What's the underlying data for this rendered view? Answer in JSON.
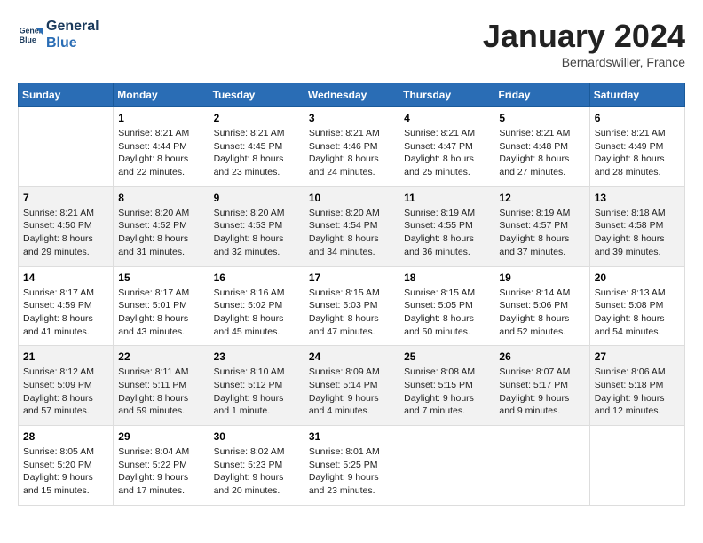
{
  "header": {
    "logo_line1": "General",
    "logo_line2": "Blue",
    "month": "January 2024",
    "location": "Bernardswiller, France"
  },
  "columns": [
    "Sunday",
    "Monday",
    "Tuesday",
    "Wednesday",
    "Thursday",
    "Friday",
    "Saturday"
  ],
  "rows": [
    [
      {
        "day": "",
        "info": ""
      },
      {
        "day": "1",
        "info": "Sunrise: 8:21 AM\nSunset: 4:44 PM\nDaylight: 8 hours\nand 22 minutes."
      },
      {
        "day": "2",
        "info": "Sunrise: 8:21 AM\nSunset: 4:45 PM\nDaylight: 8 hours\nand 23 minutes."
      },
      {
        "day": "3",
        "info": "Sunrise: 8:21 AM\nSunset: 4:46 PM\nDaylight: 8 hours\nand 24 minutes."
      },
      {
        "day": "4",
        "info": "Sunrise: 8:21 AM\nSunset: 4:47 PM\nDaylight: 8 hours\nand 25 minutes."
      },
      {
        "day": "5",
        "info": "Sunrise: 8:21 AM\nSunset: 4:48 PM\nDaylight: 8 hours\nand 27 minutes."
      },
      {
        "day": "6",
        "info": "Sunrise: 8:21 AM\nSunset: 4:49 PM\nDaylight: 8 hours\nand 28 minutes."
      }
    ],
    [
      {
        "day": "7",
        "info": "Sunrise: 8:21 AM\nSunset: 4:50 PM\nDaylight: 8 hours\nand 29 minutes."
      },
      {
        "day": "8",
        "info": "Sunrise: 8:20 AM\nSunset: 4:52 PM\nDaylight: 8 hours\nand 31 minutes."
      },
      {
        "day": "9",
        "info": "Sunrise: 8:20 AM\nSunset: 4:53 PM\nDaylight: 8 hours\nand 32 minutes."
      },
      {
        "day": "10",
        "info": "Sunrise: 8:20 AM\nSunset: 4:54 PM\nDaylight: 8 hours\nand 34 minutes."
      },
      {
        "day": "11",
        "info": "Sunrise: 8:19 AM\nSunset: 4:55 PM\nDaylight: 8 hours\nand 36 minutes."
      },
      {
        "day": "12",
        "info": "Sunrise: 8:19 AM\nSunset: 4:57 PM\nDaylight: 8 hours\nand 37 minutes."
      },
      {
        "day": "13",
        "info": "Sunrise: 8:18 AM\nSunset: 4:58 PM\nDaylight: 8 hours\nand 39 minutes."
      }
    ],
    [
      {
        "day": "14",
        "info": "Sunrise: 8:17 AM\nSunset: 4:59 PM\nDaylight: 8 hours\nand 41 minutes."
      },
      {
        "day": "15",
        "info": "Sunrise: 8:17 AM\nSunset: 5:01 PM\nDaylight: 8 hours\nand 43 minutes."
      },
      {
        "day": "16",
        "info": "Sunrise: 8:16 AM\nSunset: 5:02 PM\nDaylight: 8 hours\nand 45 minutes."
      },
      {
        "day": "17",
        "info": "Sunrise: 8:15 AM\nSunset: 5:03 PM\nDaylight: 8 hours\nand 47 minutes."
      },
      {
        "day": "18",
        "info": "Sunrise: 8:15 AM\nSunset: 5:05 PM\nDaylight: 8 hours\nand 50 minutes."
      },
      {
        "day": "19",
        "info": "Sunrise: 8:14 AM\nSunset: 5:06 PM\nDaylight: 8 hours\nand 52 minutes."
      },
      {
        "day": "20",
        "info": "Sunrise: 8:13 AM\nSunset: 5:08 PM\nDaylight: 8 hours\nand 54 minutes."
      }
    ],
    [
      {
        "day": "21",
        "info": "Sunrise: 8:12 AM\nSunset: 5:09 PM\nDaylight: 8 hours\nand 57 minutes."
      },
      {
        "day": "22",
        "info": "Sunrise: 8:11 AM\nSunset: 5:11 PM\nDaylight: 8 hours\nand 59 minutes."
      },
      {
        "day": "23",
        "info": "Sunrise: 8:10 AM\nSunset: 5:12 PM\nDaylight: 9 hours\nand 1 minute."
      },
      {
        "day": "24",
        "info": "Sunrise: 8:09 AM\nSunset: 5:14 PM\nDaylight: 9 hours\nand 4 minutes."
      },
      {
        "day": "25",
        "info": "Sunrise: 8:08 AM\nSunset: 5:15 PM\nDaylight: 9 hours\nand 7 minutes."
      },
      {
        "day": "26",
        "info": "Sunrise: 8:07 AM\nSunset: 5:17 PM\nDaylight: 9 hours\nand 9 minutes."
      },
      {
        "day": "27",
        "info": "Sunrise: 8:06 AM\nSunset: 5:18 PM\nDaylight: 9 hours\nand 12 minutes."
      }
    ],
    [
      {
        "day": "28",
        "info": "Sunrise: 8:05 AM\nSunset: 5:20 PM\nDaylight: 9 hours\nand 15 minutes."
      },
      {
        "day": "29",
        "info": "Sunrise: 8:04 AM\nSunset: 5:22 PM\nDaylight: 9 hours\nand 17 minutes."
      },
      {
        "day": "30",
        "info": "Sunrise: 8:02 AM\nSunset: 5:23 PM\nDaylight: 9 hours\nand 20 minutes."
      },
      {
        "day": "31",
        "info": "Sunrise: 8:01 AM\nSunset: 5:25 PM\nDaylight: 9 hours\nand 23 minutes."
      },
      {
        "day": "",
        "info": ""
      },
      {
        "day": "",
        "info": ""
      },
      {
        "day": "",
        "info": ""
      }
    ]
  ]
}
